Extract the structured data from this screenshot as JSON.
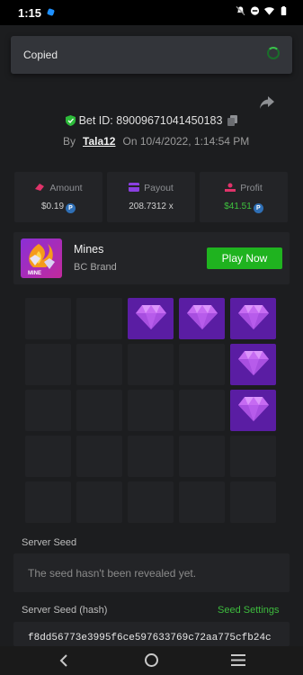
{
  "status_bar": {
    "time": "1:15",
    "icons": [
      "notifications-off-icon",
      "do-not-disturb-icon",
      "wifi-icon",
      "battery-icon"
    ]
  },
  "toast": {
    "text": "Copied"
  },
  "bet": {
    "id_label": "Bet ID: 89009671041450183",
    "by_label": "By",
    "user": "Tala12",
    "on_label": "On",
    "date": "10/4/2022, 1:14:54 PM"
  },
  "stats": [
    {
      "label": "Amount",
      "value": "$0.19",
      "icon": "amount-icon",
      "color": "#cfcfcf"
    },
    {
      "label": "Payout",
      "value": "208.7312 x",
      "icon": "payout-icon",
      "color": "#cfcfcf"
    },
    {
      "label": "Profit",
      "value": "$41.51",
      "icon": "profit-icon",
      "color": "#3ec23e"
    }
  ],
  "coin_symbol": "P",
  "game": {
    "title": "Mines",
    "provider": "BC Brand",
    "thumb_text": "MINE",
    "play_label": "Play Now"
  },
  "grid": {
    "rows": 5,
    "cols": 5,
    "gems": [
      [
        0,
        2
      ],
      [
        0,
        3
      ],
      [
        0,
        4
      ],
      [
        1,
        4
      ],
      [
        2,
        4
      ]
    ]
  },
  "server_seed": {
    "label": "Server Seed",
    "placeholder": "The seed hasn't been revealed yet."
  },
  "server_seed_hash": {
    "label": "Server Seed (hash)",
    "settings_label": "Seed Settings",
    "value": "f8dd56773e3995f6ce597633769c72aa775cfb24c"
  },
  "nav": {
    "buttons": [
      "back-icon",
      "home-icon",
      "recents-icon"
    ]
  },
  "colors": {
    "accent_green": "#1fb31f",
    "gem_purple": "#5a1da3",
    "panel": "#232427"
  }
}
